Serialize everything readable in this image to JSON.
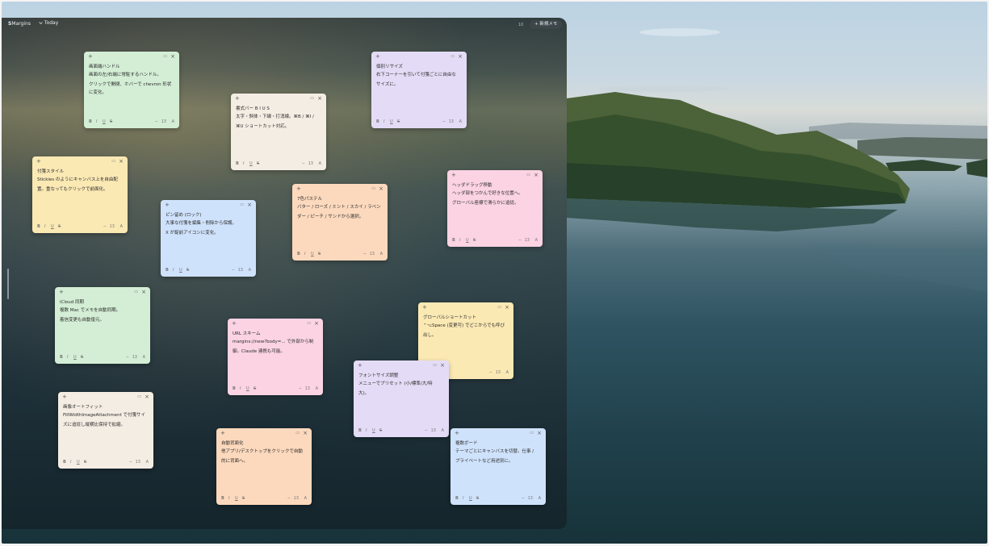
{
  "app": {
    "name_bold": "S",
    "name_rest": "Margins",
    "view_label": "Today",
    "note_count": "10",
    "new_note_label": "+ 新規メモ"
  },
  "toolbar_glyphs": {
    "bold": "B",
    "italic": "I",
    "underline": "U",
    "strike": "S",
    "minus": "−",
    "size": "13",
    "font": "A"
  },
  "notes": [
    {
      "color": "green",
      "lines": [
        "画面端ハンドル",
        "画面の左/右端に常駐するハンドル。",
        "クリックで開閉、ホバーで chevron 形状",
        "に変化。"
      ]
    },
    {
      "color": "lav",
      "lines": [
        "個別リサイズ",
        "右下コーナーを引いて付箋ごとに自由な",
        "サイズに。"
      ]
    },
    {
      "color": "cream",
      "lines": [
        "書式バー B I U S",
        "太字・斜体・下線・打消線。⌘B / ⌘I /",
        "⌘U ショートカット対応。"
      ]
    },
    {
      "color": "yellow",
      "lines": [
        "付箋スタイル",
        "Stickies のようにキャンバス上を自由配",
        "置。重なってもクリックで前面化。"
      ]
    },
    {
      "color": "pink",
      "lines": [
        "ヘッダドラッグ移動",
        "ヘッダ部をつかんで好きな位置へ。",
        "グローバル座標で滑らかに追従。"
      ]
    },
    {
      "color": "peach",
      "lines": [
        "7色パステル",
        "バター / ローズ / ミント / スカイ / ラベン",
        "ダー / ピーチ / サンドから選択。"
      ]
    },
    {
      "color": "blue",
      "lines": [
        "ピン留め (ロック)",
        "大事な付箋を編集・削除から保護。",
        "X が錠前アイコンに変化。"
      ]
    },
    {
      "color": "green",
      "lines": [
        "iCloud 同期",
        "複数 Mac でメモを自動同期。",
        "着信変更も自動復元。"
      ]
    },
    {
      "color": "yellow",
      "lines": [
        "グローバルショートカット",
        "⌃⌥Space (変更可) でどこからでも呼び",
        "出し。"
      ]
    },
    {
      "color": "pink",
      "lines": [
        "URL スキーム",
        "margins://new?body=... で外部から制",
        "御。Claude 連携も可能。"
      ]
    },
    {
      "color": "lav",
      "lines": [
        "フォントサイズ調整",
        "メニューでプリセット (小/標準/大/特",
        "大)。"
      ]
    },
    {
      "color": "cream",
      "lines": [
        "画像オートフィット",
        "FillWidthImageAttachment で付箋サイ",
        "ズに追従し縦横比保持で拡縮。"
      ]
    },
    {
      "color": "peach",
      "lines": [
        "自動背面化",
        "他アプリ/デスクトップをクリックで自動",
        "的に背面へ。"
      ]
    },
    {
      "color": "blue",
      "lines": [
        "複数ボード",
        "テーマごとにキャンバスを切替。仕事 /",
        "プライベートなど用途別に。"
      ]
    }
  ]
}
